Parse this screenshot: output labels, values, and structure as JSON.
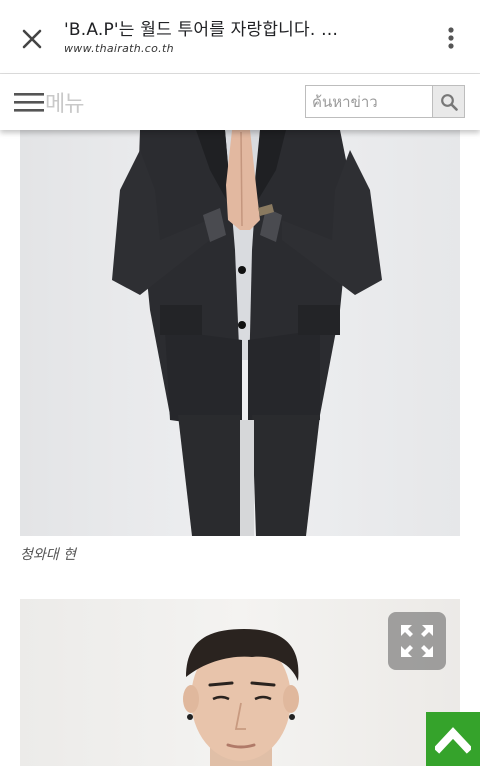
{
  "browser": {
    "title": "'B.A.P'는 월드 투어를 자랑합니다. …",
    "url": "www.thairath.co.th",
    "close_icon": "close-icon",
    "more_icon": "kebab-menu-icon"
  },
  "header": {
    "menu_label": "메뉴",
    "menu_icon": "hamburger-icon",
    "search_placeholder": "ค้นหาข่าว",
    "search_icon": "search-icon"
  },
  "article": {
    "photos": [
      {
        "caption": "청와대 현"
      },
      {
        "caption": ""
      }
    ],
    "expand_icon": "expand-icon"
  },
  "controls": {
    "scroll_top_icon": "chevron-up-icon"
  },
  "colors": {
    "accent_green": "#35a32b",
    "suit": "#2a2b2e",
    "photo_bg": "#e8e9eb"
  }
}
